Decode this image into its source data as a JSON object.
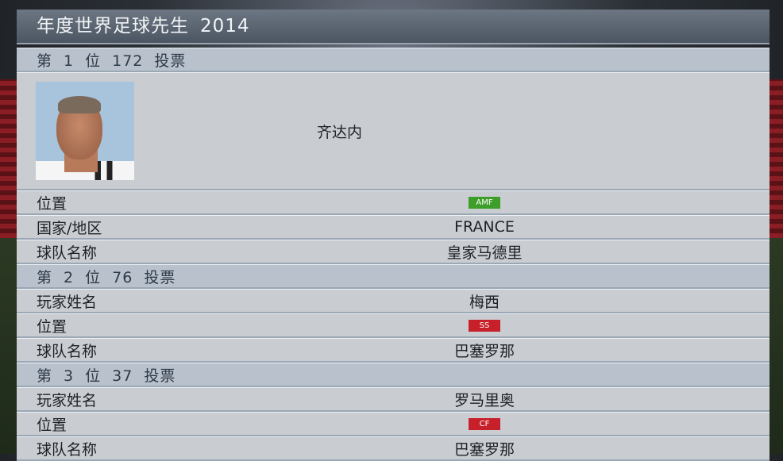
{
  "title": "年度世界足球先生",
  "year": "2014",
  "entries": [
    {
      "rank_word": "第",
      "rank_num": "1",
      "rank_unit": "位",
      "votes": "172",
      "votes_word": "投票",
      "player_name": "齐达内",
      "fields": [
        {
          "label": "位置",
          "position": "AMF",
          "position_color": "#3e9e2a"
        },
        {
          "label": "国家/地区",
          "value": "FRANCE"
        },
        {
          "label": "球队名称",
          "value": "皇家马德里"
        }
      ]
    },
    {
      "rank_word": "第",
      "rank_num": "2",
      "rank_unit": "位",
      "votes": "76",
      "votes_word": "投票",
      "fields": [
        {
          "label": "玩家姓名",
          "value": "梅西"
        },
        {
          "label": "位置",
          "position": "SS",
          "position_color": "#c8202a"
        },
        {
          "label": "球队名称",
          "value": "巴塞罗那"
        }
      ]
    },
    {
      "rank_word": "第",
      "rank_num": "3",
      "rank_unit": "位",
      "votes": "37",
      "votes_word": "投票",
      "fields": [
        {
          "label": "玩家姓名",
          "value": "罗马里奥"
        },
        {
          "label": "位置",
          "position": "CF",
          "position_color": "#c8202a"
        },
        {
          "label": "球队名称",
          "value": "巴塞罗那"
        }
      ]
    }
  ]
}
